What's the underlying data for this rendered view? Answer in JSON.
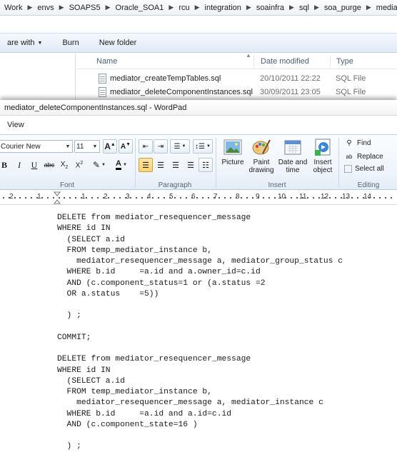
{
  "explorer": {
    "breadcrumbs": [
      "Work",
      "envs",
      "SOAPS5",
      "Oracle_SOA1",
      "rcu",
      "integration",
      "soainfra",
      "sql",
      "soa_purge",
      "mediator"
    ],
    "commands": {
      "share_with": "are with",
      "burn": "Burn",
      "new_folder": "New folder"
    },
    "columns": {
      "name": "Name",
      "date_modified": "Date modified",
      "type": "Type"
    },
    "files": [
      {
        "name": "mediator_createTempTables.sql",
        "date": "20/10/2011 22:22",
        "type": "SQL File"
      },
      {
        "name": "mediator_deleteComponentInstances.sql",
        "date": "30/09/2011 23:05",
        "type": "SQL File"
      }
    ]
  },
  "wordpad": {
    "title": "mediator_deleteComponentInstances.sql - WordPad",
    "tabs": [
      "View"
    ],
    "font": {
      "family": "Courier New",
      "size": "11",
      "group_label": "Font"
    },
    "paragraph": {
      "group_label": "Paragraph"
    },
    "insert": {
      "group_label": "Insert",
      "picture": "Picture",
      "paint_drawing_1": "Paint",
      "paint_drawing_2": "drawing",
      "date_time_1": "Date and",
      "date_time_2": "time",
      "insert_object_1": "Insert",
      "insert_object_2": "object"
    },
    "editing": {
      "group_label": "Editing",
      "find": "Find",
      "replace": "Replace",
      "select_all": "Select all"
    },
    "ruler_numbers": [
      "2",
      "1",
      "1",
      "2",
      "3",
      "4",
      "5",
      "6",
      "7",
      "8",
      "9",
      "10",
      "11",
      "12",
      "13",
      "14"
    ],
    "document_lines": [
      "DELETE from mediator_resequencer_message",
      "WHERE id IN",
      "  (SELECT a.id",
      "  FROM temp_mediator_instance b,",
      "    mediator_resequencer_message a, mediator_group_status c",
      "  WHERE b.id     =a.id and a.owner_id=c.id",
      "  AND (c.component_status=1 or (a.status =2",
      "  OR a.status    =5))",
      "",
      "  ) ;",
      "",
      "COMMIT;",
      "",
      "DELETE from mediator_resequencer_message",
      "WHERE id IN",
      "  (SELECT a.id",
      "  FROM temp_mediator_instance b,",
      "    mediator_resequencer_message a, mediator_instance c",
      "  WHERE b.id     =a.id and a.id=c.id",
      "  AND (c.component_state=16 )",
      "",
      "  ) ;"
    ]
  },
  "colors": {
    "ribbon_top": "#fbfdff",
    "ribbon_bottom": "#e3ecf6",
    "selected_button": "#fcd371",
    "group_label": "#55667a"
  }
}
